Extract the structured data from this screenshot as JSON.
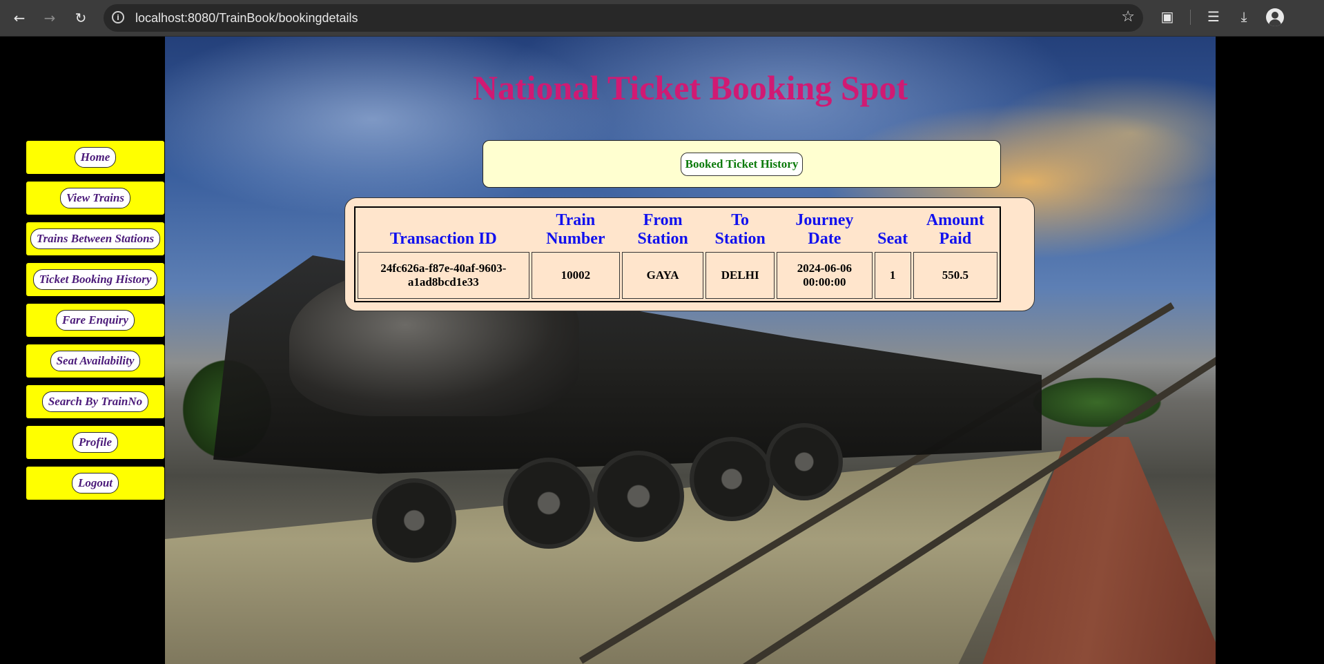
{
  "browser": {
    "url": "localhost:8080/TrainBook/bookingdetails"
  },
  "page": {
    "title": "National Ticket Booking Spot"
  },
  "sidebar": {
    "items": [
      {
        "label": "Home"
      },
      {
        "label": "View Trains"
      },
      {
        "label": "Trains Between Stations"
      },
      {
        "label": "Ticket Booking History"
      },
      {
        "label": "Fare Enquiry"
      },
      {
        "label": "Seat Availability"
      },
      {
        "label": "Search By TrainNo"
      },
      {
        "label": "Profile"
      },
      {
        "label": "Logout"
      }
    ]
  },
  "history": {
    "heading": "Booked Ticket History",
    "columns": [
      "Transaction ID",
      "Train Number",
      "From Station",
      "To Station",
      "Journey Date",
      "Seat",
      "Amount Paid"
    ],
    "rows": [
      [
        "24fc626a-f87e-40af-9603-a1ad8bcd1e33",
        "10002",
        "GAYA",
        "DELHI",
        "2024-06-06 00:00:00",
        "1",
        "550.5"
      ]
    ]
  },
  "colors": {
    "title": "#d01a73",
    "sidebar_bg": "#ffff00",
    "sidebar_text": "#4b1a7a",
    "header_text": "#1111ee",
    "history_heading": "#0a7a0a",
    "table_box": "#ffe5cc",
    "header_box": "#ffffd0"
  },
  "icons": [
    "back-icon",
    "forward-icon",
    "reload-icon",
    "site-info-icon",
    "bookmark-star-icon",
    "extensions-icon",
    "media-icon",
    "download-icon",
    "profile-icon"
  ]
}
